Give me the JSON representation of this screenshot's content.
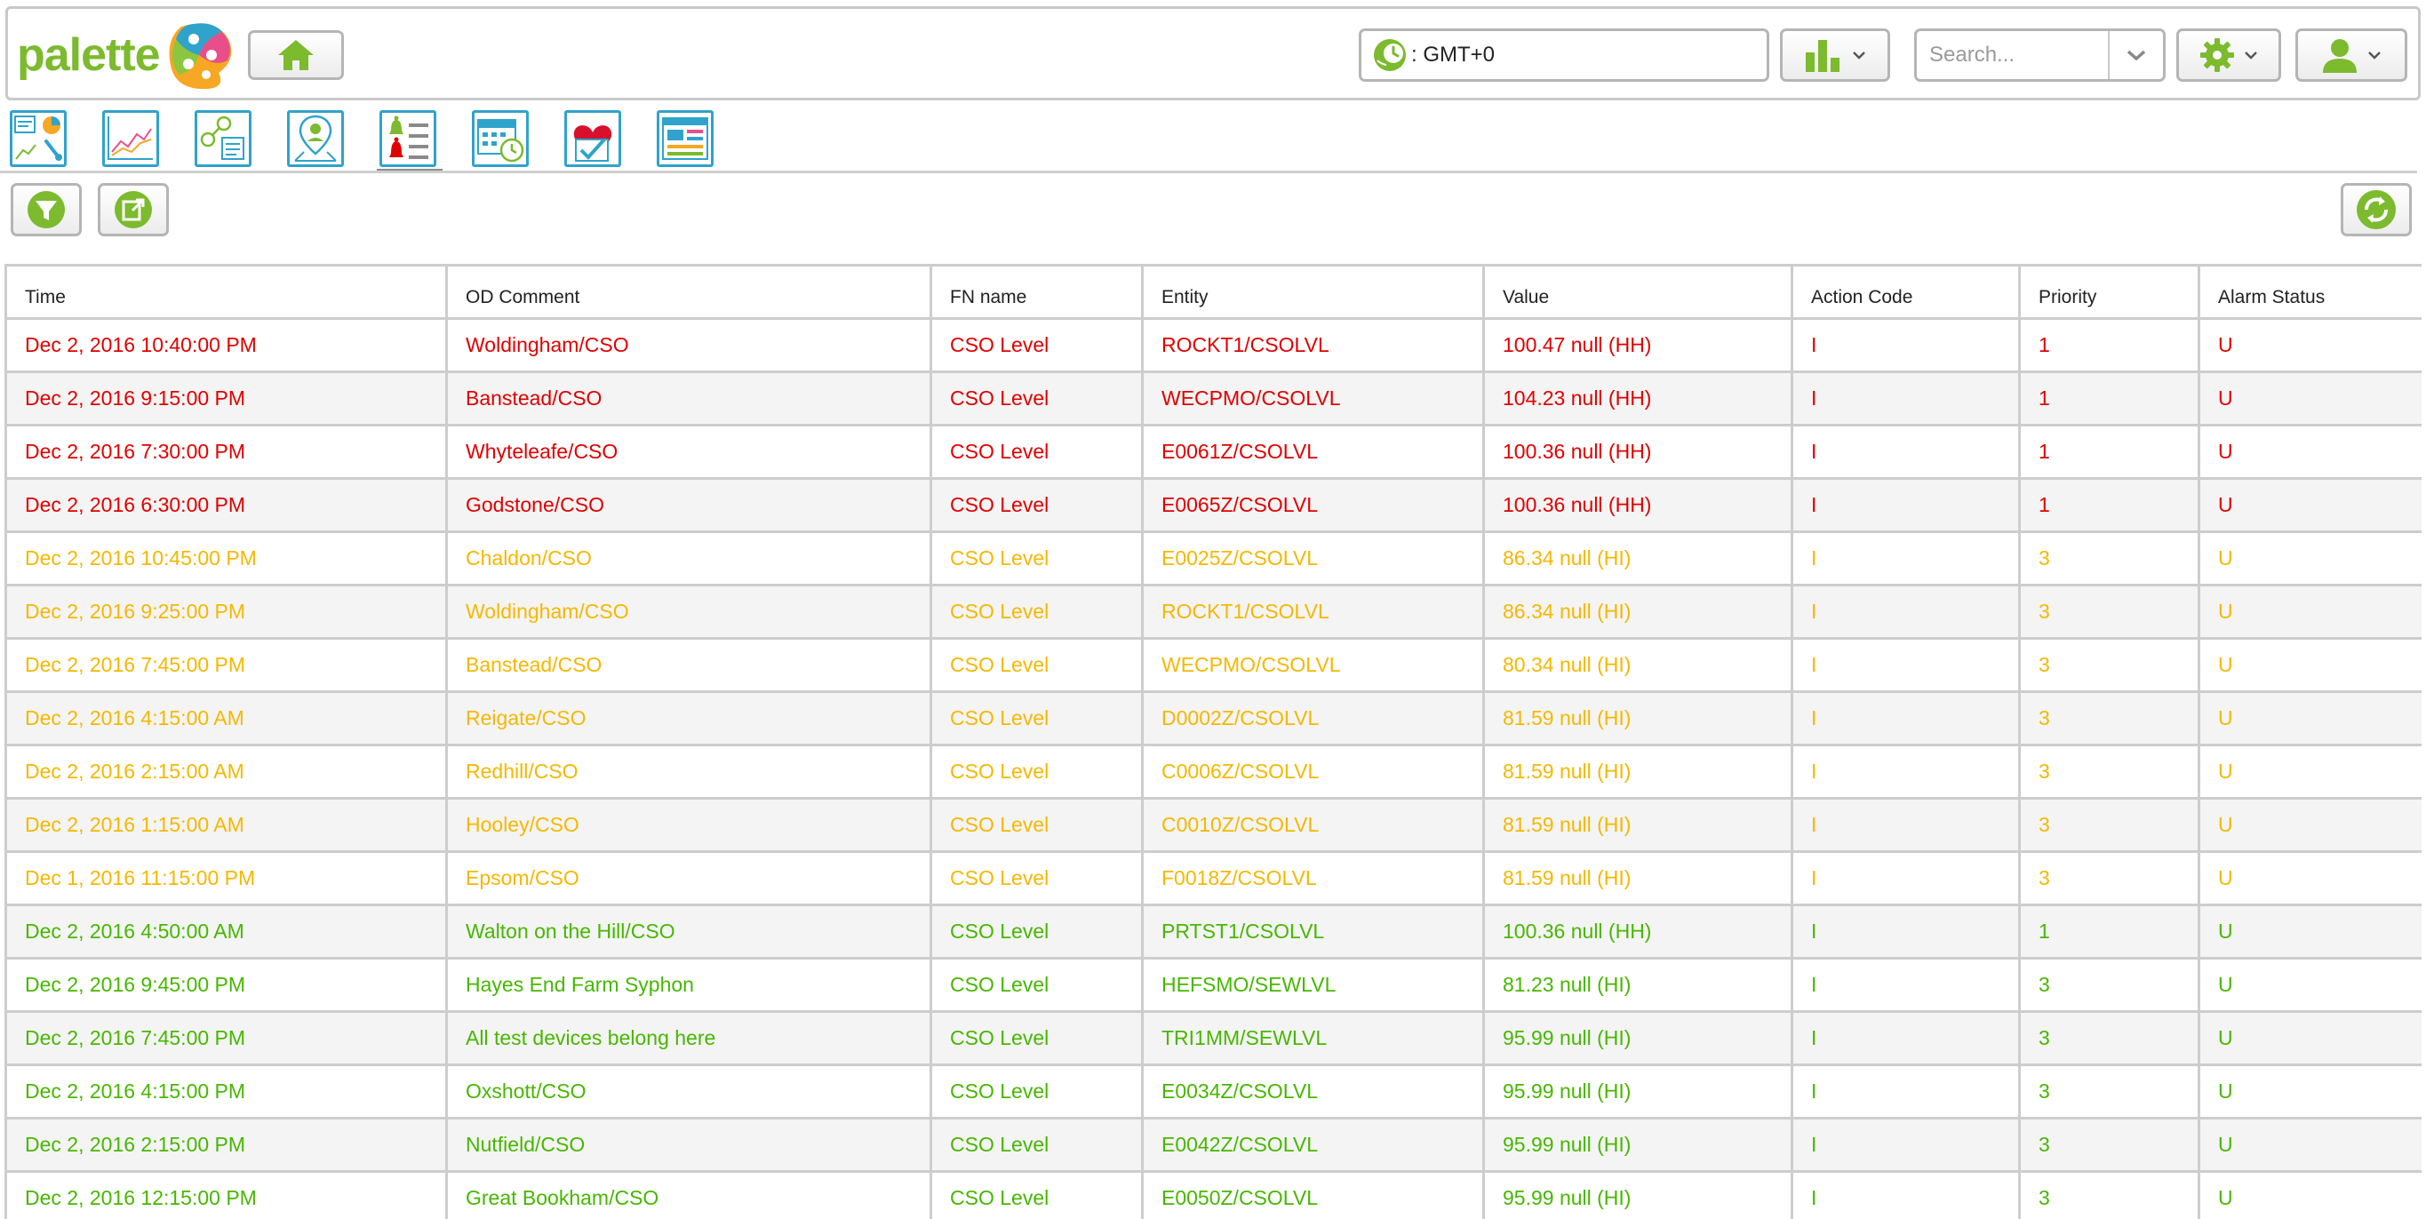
{
  "header": {
    "brand": "palette",
    "timezone": ": GMT+0",
    "search_placeholder": "Search..."
  },
  "toolbar": {
    "tools": [
      {
        "icon": "dashboard-icon"
      },
      {
        "icon": "trend-chart-icon"
      },
      {
        "icon": "network-tools-icon"
      },
      {
        "icon": "map-user-icon"
      },
      {
        "icon": "alarm-list-icon",
        "active": true
      },
      {
        "icon": "calendar-clock-icon"
      },
      {
        "icon": "health-check-icon"
      },
      {
        "icon": "report-panel-icon"
      }
    ]
  },
  "colors": {
    "red": "#e00000",
    "orange": "#f5b800",
    "green": "#47b700",
    "accent_blue": "#2fa3cc",
    "icon_green": "#7cba2e"
  },
  "table": {
    "columns": [
      "Time",
      "OD Comment",
      "FN name",
      "Entity",
      "Value",
      "Action Code",
      "Priority",
      "Alarm Status"
    ],
    "rows": [
      {
        "severity": "red",
        "cells": [
          "Dec 2, 2016 10:40:00 PM",
          "Woldingham/CSO",
          "CSO Level",
          "ROCKT1/CSOLVL",
          "100.47 null (HH)",
          "I",
          "1",
          "U"
        ]
      },
      {
        "severity": "red",
        "cells": [
          "Dec 2, 2016 9:15:00 PM",
          "Banstead/CSO",
          "CSO Level",
          "WECPMO/CSOLVL",
          "104.23 null (HH)",
          "I",
          "1",
          "U"
        ]
      },
      {
        "severity": "red",
        "cells": [
          "Dec 2, 2016 7:30:00 PM",
          "Whyteleafe/CSO",
          "CSO Level",
          "E0061Z/CSOLVL",
          "100.36 null (HH)",
          "I",
          "1",
          "U"
        ]
      },
      {
        "severity": "red",
        "cells": [
          "Dec 2, 2016 6:30:00 PM",
          "Godstone/CSO",
          "CSO Level",
          "E0065Z/CSOLVL",
          "100.36 null (HH)",
          "I",
          "1",
          "U"
        ]
      },
      {
        "severity": "orange",
        "cells": [
          "Dec 2, 2016 10:45:00 PM",
          "Chaldon/CSO",
          "CSO Level",
          "E0025Z/CSOLVL",
          "86.34 null (HI)",
          "I",
          "3",
          "U"
        ]
      },
      {
        "severity": "orange",
        "cells": [
          "Dec 2, 2016 9:25:00 PM",
          "Woldingham/CSO",
          "CSO Level",
          "ROCKT1/CSOLVL",
          "86.34 null (HI)",
          "I",
          "3",
          "U"
        ]
      },
      {
        "severity": "orange",
        "cells": [
          "Dec 2, 2016 7:45:00 PM",
          "Banstead/CSO",
          "CSO Level",
          "WECPMO/CSOLVL",
          "80.34 null (HI)",
          "I",
          "3",
          "U"
        ]
      },
      {
        "severity": "orange",
        "cells": [
          "Dec 2, 2016 4:15:00 AM",
          "Reigate/CSO",
          "CSO Level",
          "D0002Z/CSOLVL",
          "81.59 null (HI)",
          "I",
          "3",
          "U"
        ]
      },
      {
        "severity": "orange",
        "cells": [
          "Dec 2, 2016 2:15:00 AM",
          "Redhill/CSO",
          "CSO Level",
          "C0006Z/CSOLVL",
          "81.59 null (HI)",
          "I",
          "3",
          "U"
        ]
      },
      {
        "severity": "orange",
        "cells": [
          "Dec 2, 2016 1:15:00 AM",
          "Hooley/CSO",
          "CSO Level",
          "C0010Z/CSOLVL",
          "81.59 null (HI)",
          "I",
          "3",
          "U"
        ]
      },
      {
        "severity": "orange",
        "cells": [
          "Dec 1, 2016 11:15:00 PM",
          "Epsom/CSO",
          "CSO Level",
          "F0018Z/CSOLVL",
          "81.59 null (HI)",
          "I",
          "3",
          "U"
        ]
      },
      {
        "severity": "green",
        "cells": [
          "Dec 2, 2016 4:50:00 AM",
          "Walton on the Hill/CSO",
          "CSO Level",
          "PRTST1/CSOLVL",
          "100.36 null (HH)",
          "I",
          "1",
          "U"
        ]
      },
      {
        "severity": "green",
        "cells": [
          "Dec 2, 2016 9:45:00 PM",
          "Hayes End Farm Syphon",
          "CSO Level",
          "HEFSMO/SEWLVL",
          "81.23 null (HI)",
          "I",
          "3",
          "U"
        ]
      },
      {
        "severity": "green",
        "cells": [
          "Dec 2, 2016 7:45:00 PM",
          "All test devices belong here",
          "CSO Level",
          "TRI1MM/SEWLVL",
          "95.99 null (HI)",
          "I",
          "3",
          "U"
        ]
      },
      {
        "severity": "green",
        "cells": [
          "Dec 2, 2016 4:15:00 PM",
          "Oxshott/CSO",
          "CSO Level",
          "E0034Z/CSOLVL",
          "95.99 null (HI)",
          "I",
          "3",
          "U"
        ]
      },
      {
        "severity": "green",
        "cells": [
          "Dec 2, 2016 2:15:00 PM",
          "Nutfield/CSO",
          "CSO Level",
          "E0042Z/CSOLVL",
          "95.99 null (HI)",
          "I",
          "3",
          "U"
        ]
      },
      {
        "severity": "green",
        "cells": [
          "Dec 2, 2016 12:15:00 PM",
          "Great Bookham/CSO",
          "CSO Level",
          "E0050Z/CSOLVL",
          "95.99 null (HI)",
          "I",
          "3",
          "U"
        ]
      }
    ]
  }
}
